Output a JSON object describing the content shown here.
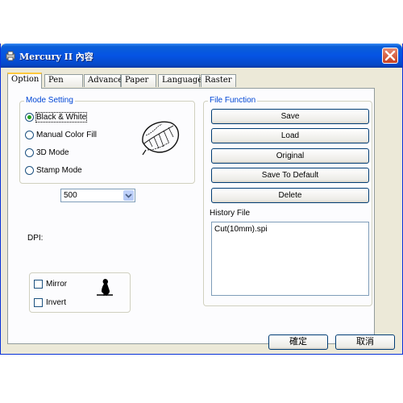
{
  "window": {
    "title": "Mercury II 內容"
  },
  "tabs": [
    "Option",
    "Pen",
    "Advance",
    "Paper",
    "Language",
    "Raster"
  ],
  "mode_setting": {
    "title": "Mode Setting",
    "options": [
      "Black & White",
      "Manual Color Fill",
      "3D Mode",
      "Stamp Mode"
    ],
    "selected": "Black & White"
  },
  "dpi": {
    "label": "DPI:",
    "value": "500"
  },
  "mirror_label": "Mirror",
  "invert_label": "Invert",
  "file_function": {
    "title": "File Function",
    "buttons": [
      "Save",
      "Load",
      "Original",
      "Save To Default",
      "Delete"
    ]
  },
  "history": {
    "label": "History File",
    "items": [
      "Cut(10mm).spi"
    ]
  },
  "dialog": {
    "ok": "確定",
    "cancel": "取消"
  },
  "colors": {
    "title_bar": "#0554e3",
    "group_title": "#0046d5",
    "radio_dot": "#21a121"
  }
}
